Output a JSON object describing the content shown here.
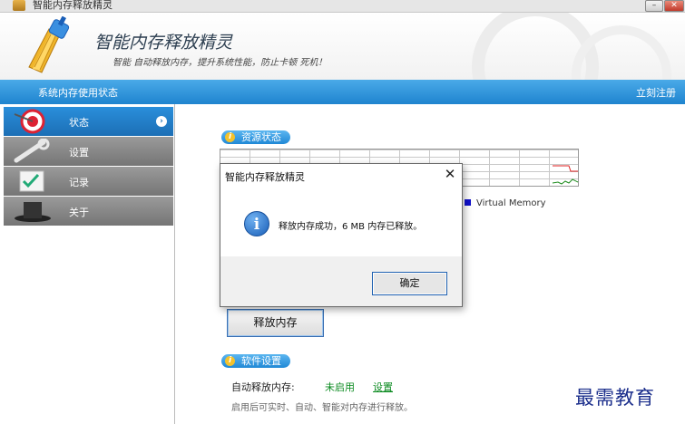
{
  "window": {
    "title": "智能内存释放精灵",
    "minimize_label": "–",
    "close_label": "✕"
  },
  "header": {
    "title": "智能内存释放精灵",
    "subtitle": "智能 自动释放内存，提升系统性能，防止卡顿 死机！"
  },
  "bluebar": {
    "section_title": "系统内存使用状态",
    "register_label": "立刻注册"
  },
  "sidebar": {
    "items": [
      {
        "label": "状态",
        "active": true,
        "arrow": "›"
      },
      {
        "label": "设置",
        "active": false
      },
      {
        "label": "记录",
        "active": false
      },
      {
        "label": "关于",
        "active": false
      }
    ]
  },
  "main": {
    "resource_section": {
      "label": "资源状态",
      "icon": "i"
    },
    "legend_virtual_memory": "Virtual Memory",
    "release_button_label": "释放内存",
    "software_section": {
      "label": "软件设置",
      "icon": "i"
    },
    "auto_release_label": "自动释放内存:",
    "auto_release_state": "未启用",
    "auto_release_settings_link": "设置",
    "auto_release_desc": "启用后可实时、自动、智能对内存进行释放。"
  },
  "dialog": {
    "title": "智能内存释放精灵",
    "close_glyph": "✕",
    "icon_glyph": "i",
    "message": "释放内存成功，6 MB 内存已释放。",
    "ok_label": "确定"
  },
  "watermark": "最需教育",
  "colors": {
    "accent_blue": "#1f84cf",
    "status_green": "#0a8a1f",
    "legend_blue": "#1010cc"
  }
}
